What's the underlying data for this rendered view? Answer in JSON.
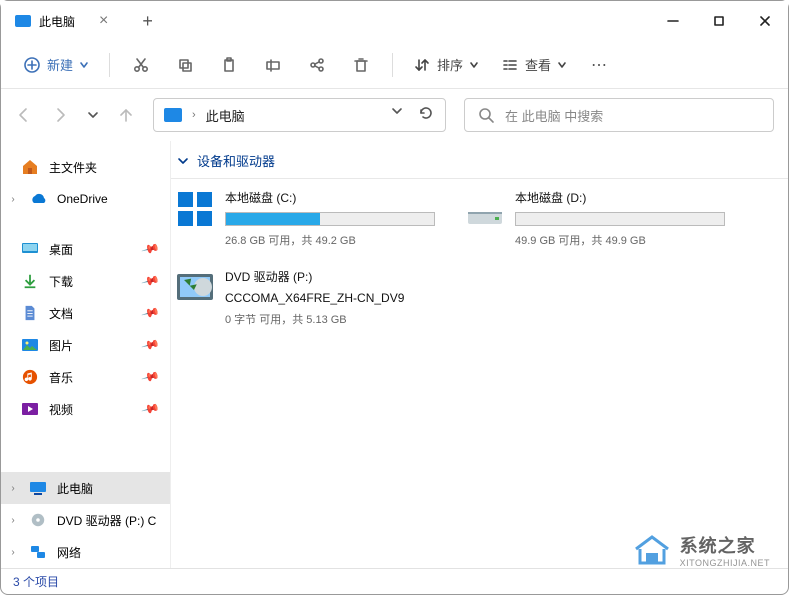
{
  "titlebar": {
    "tab_title": "此电脑"
  },
  "toolbar": {
    "new_label": "新建",
    "sort_label": "排序",
    "view_label": "查看"
  },
  "addressbar": {
    "path_text": "此电脑"
  },
  "searchbox": {
    "placeholder_text": "在 此电脑 中搜索"
  },
  "sidebar": {
    "home": "主文件夹",
    "onedrive": "OneDrive",
    "desktop": "桌面",
    "downloads": "下载",
    "documents": "文档",
    "pictures": "图片",
    "music": "音乐",
    "videos": "视频",
    "this_pc": "此电脑",
    "dvd_drive": "DVD 驱动器 (P:) C",
    "network": "网络"
  },
  "section": {
    "devices_drives": "设备和驱动器"
  },
  "drives": {
    "c": {
      "title": "本地磁盘 (C:)",
      "sub": "26.8 GB 可用，共 49.2 GB",
      "fill_percent": 45
    },
    "d": {
      "title": "本地磁盘 (D:)",
      "sub": "49.9 GB 可用，共 49.9 GB",
      "fill_percent": 0
    },
    "dvd": {
      "line1": "DVD 驱动器 (P:)",
      "line2": "CCCOMA_X64FRE_ZH-CN_DV9",
      "sub": "0 字节 可用，共 5.13 GB"
    }
  },
  "statusbar": {
    "items_text": "3 个项目"
  },
  "watermark": {
    "title": "系统之家",
    "sub": "XITONGZHIJIA.NET"
  }
}
